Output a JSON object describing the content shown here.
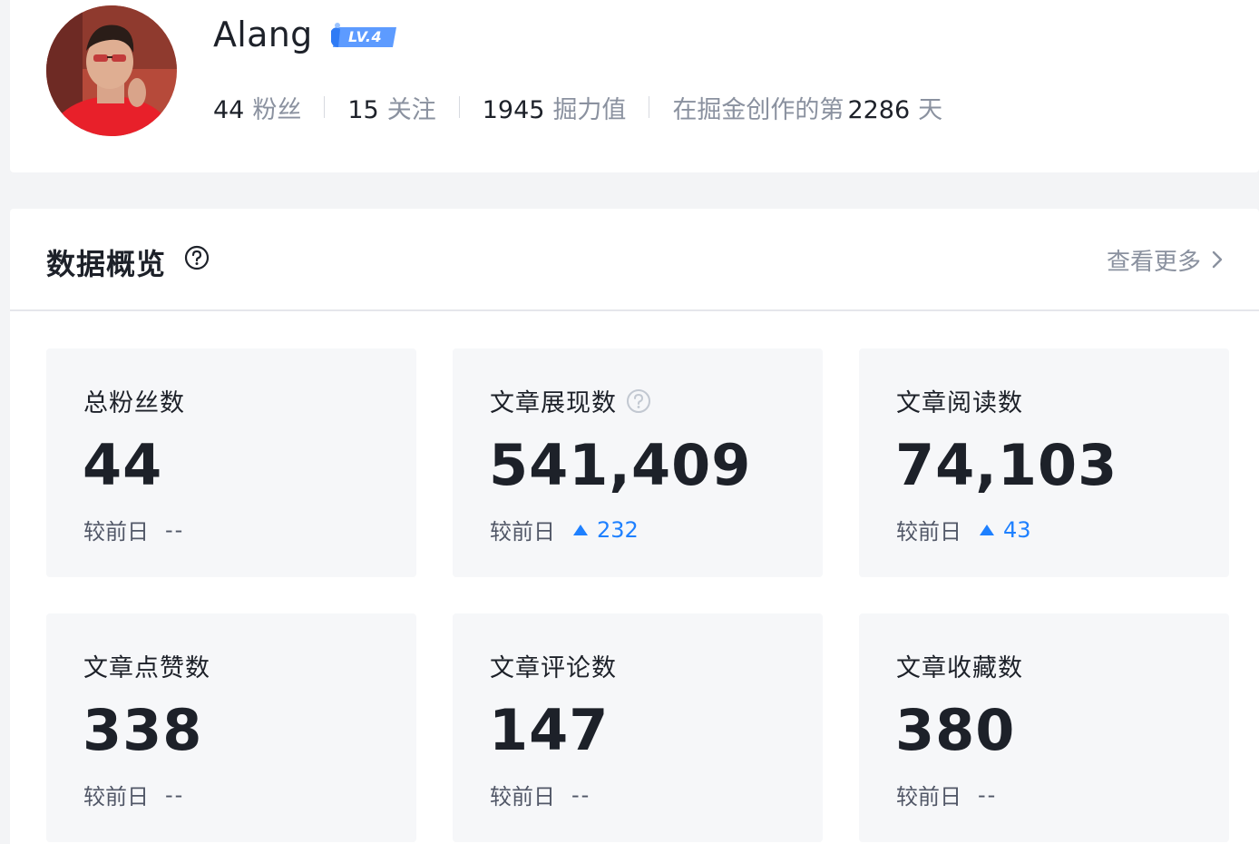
{
  "profile": {
    "username": "Alang",
    "level": "LV.4",
    "stats": [
      {
        "value": "44",
        "label": "粉丝"
      },
      {
        "value": "15",
        "label": "关注"
      },
      {
        "value": "1945",
        "label": "掘力值"
      }
    ],
    "creation_days": {
      "prefix": "在掘金创作的第",
      "value": "2286",
      "suffix": "天"
    }
  },
  "overview": {
    "title": "数据概览",
    "more_label": "查看更多",
    "compare_label": "较前日",
    "flat_text": "--",
    "accent_color": "#1e80ff",
    "tiles": [
      {
        "label": "总粉丝数",
        "value": "44",
        "change": "--",
        "trend": "flat"
      },
      {
        "label": "文章展现数",
        "value": "541,409",
        "change": "232",
        "trend": "up"
      },
      {
        "label": "文章阅读数",
        "value": "74,103",
        "change": "43",
        "trend": "up"
      },
      {
        "label": "文章点赞数",
        "value": "338",
        "change": "--",
        "trend": "flat"
      },
      {
        "label": "文章评论数",
        "value": "147",
        "change": "--",
        "trend": "flat"
      },
      {
        "label": "文章收藏数",
        "value": "380",
        "change": "--",
        "trend": "flat"
      }
    ]
  }
}
